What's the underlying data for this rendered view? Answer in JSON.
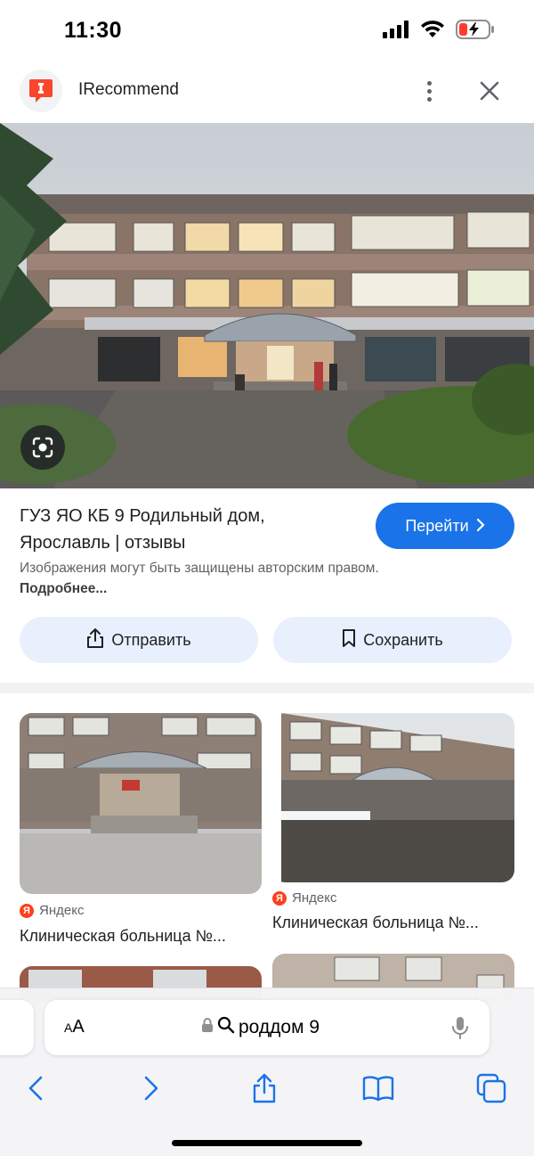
{
  "status_bar": {
    "time": "11:30",
    "icons": [
      "cellular-signal-icon",
      "wifi-icon",
      "battery-charging-icon"
    ],
    "battery_color": "#ff3b30"
  },
  "header": {
    "site_name": "IRecommend",
    "logo_color": "#f9462d",
    "icons": [
      "more-vert-icon",
      "close-icon"
    ]
  },
  "hero": {
    "alt": "building photo",
    "lens_icon": "google-lens-icon"
  },
  "result": {
    "title": "ГУЗ ЯО КБ 9 Родильный дом, Ярославль | отзывы",
    "visit_label": "Перейти",
    "copyright_text": "Изображения могут быть защищены авторским правом.",
    "copyright_link": "Подробнее...",
    "share_label": "Отправить",
    "save_label": "Сохранить",
    "accent_color": "#1a73e8"
  },
  "related": [
    {
      "source": "Яндекс",
      "title": "Клиническая больница №..."
    },
    {
      "source": "Яндекс",
      "title": "Клиническая больница №..."
    }
  ],
  "browser": {
    "aa_label_small": "A",
    "aa_label_big": "A",
    "url_text": "роддом 9",
    "icons": [
      "lock-icon",
      "search-icon",
      "microphone-icon",
      "back-icon",
      "forward-icon",
      "share-icon",
      "bookmarks-icon",
      "tabs-icon"
    ]
  }
}
